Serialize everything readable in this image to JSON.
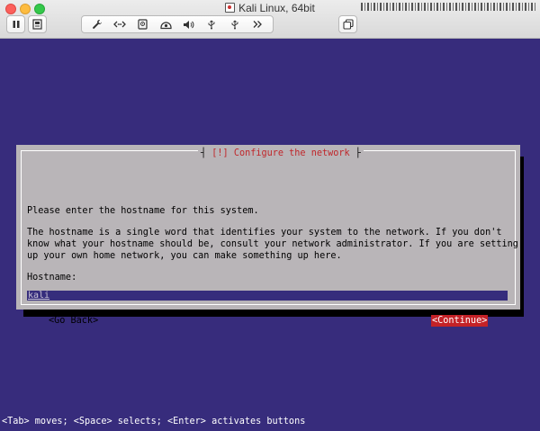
{
  "window": {
    "title": "Kali Linux, 64bit",
    "controls": [
      "close",
      "minimize",
      "maximize"
    ]
  },
  "toolbar": {
    "pause_icon": "pause-icon",
    "snapshot_icon": "snapshot-icon",
    "tools": [
      {
        "name": "settings-wrench-icon",
        "glyph": "🔧"
      },
      {
        "name": "network-arrows-icon",
        "glyph": "‹·›"
      },
      {
        "name": "hard-disk-icon",
        "glyph": "▣"
      },
      {
        "name": "camera-icon",
        "glyph": "◙"
      },
      {
        "name": "sound-icon",
        "glyph": "🔈"
      },
      {
        "name": "usb-icon",
        "glyph": "ψ"
      },
      {
        "name": "usb-icon-2",
        "glyph": "ψ"
      },
      {
        "name": "more-icon",
        "glyph": "»"
      }
    ],
    "copy_icon": "copy-window-icon"
  },
  "dialog": {
    "title_prefix": "[!]",
    "title_text": "Configure the network",
    "prompt": "Please enter the hostname for this system.",
    "description": [
      "The hostname is a single word that identifies your system to the network. If you don't",
      "know what your hostname should be, consult your network administrator. If you are setting",
      "up your own home network, you can make something up here."
    ],
    "field_label": "Hostname:",
    "field_value": "kali",
    "back_label": "<Go Back>",
    "continue_label": "<Continue>"
  },
  "status_bar": "<Tab> moves; <Space> selects; <Enter> activates buttons",
  "colors": {
    "terminal_bg": "#372c7c",
    "dialog_bg": "#b9b5b8",
    "title_red": "#c0262a",
    "button_selected": "#c42227"
  }
}
